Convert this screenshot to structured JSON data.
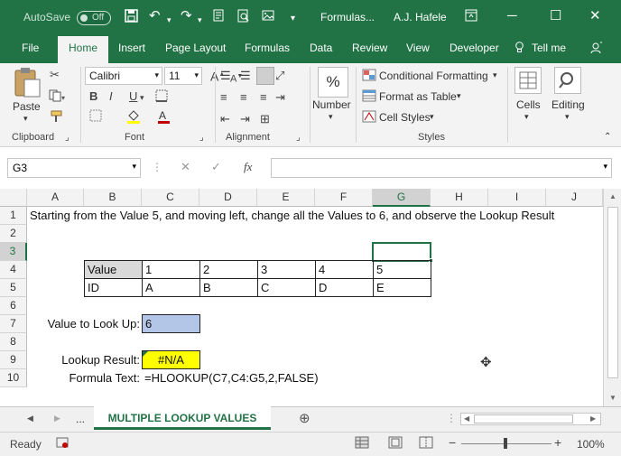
{
  "titlebar": {
    "autosave_label": "AutoSave",
    "autosave_state": "Off",
    "doc_title": "Formulas...",
    "user": "A.J. Hafele"
  },
  "tabs": [
    "File",
    "Home",
    "Insert",
    "Page Layout",
    "Formulas",
    "Data",
    "Review",
    "View",
    "Developer"
  ],
  "tellme": "Tell me",
  "ribbon": {
    "paste_label": "Paste",
    "clipboard_label": "Clipboard",
    "font_name": "Calibri",
    "font_size": "11",
    "font_label": "Font",
    "alignment_label": "Alignment",
    "number_symbol": "%",
    "number_label": "Number",
    "conditional_formatting": "Conditional Formatting",
    "format_as_table": "Format as Table",
    "cell_styles": "Cell Styles",
    "styles_label": "Styles",
    "cells_label": "Cells",
    "editing_label": "Editing"
  },
  "formula_bar": {
    "name_box": "G3",
    "fx": "fx",
    "value": ""
  },
  "columns": [
    "A",
    "B",
    "C",
    "D",
    "E",
    "F",
    "G",
    "H",
    "I",
    "J"
  ],
  "rows": [
    "1",
    "2",
    "3",
    "4",
    "5",
    "6",
    "7",
    "8",
    "9",
    "10"
  ],
  "cells": {
    "a1": "Starting from the Value 5, and moving left, change all the Values to 6, and observe the Lookup Result",
    "b4": "Value",
    "c4": "1",
    "d4": "2",
    "e4": "3",
    "f4": "4",
    "g4": "5",
    "b5": "ID",
    "c5": "A",
    "d5": "B",
    "e5": "C",
    "f5": "D",
    "g5": "E",
    "lookup_label": "Value to Look Up:",
    "lookup_value": "6",
    "result_label": "Lookup Result:",
    "result_value": "#N/A",
    "formula_label": "Formula Text:",
    "formula_text": "=HLOOKUP(C7,C4:G5,2,FALSE)"
  },
  "sheet_tab": {
    "ellipsis": "...",
    "name": "MULTIPLE LOOKUP VALUES"
  },
  "status": {
    "ready": "Ready",
    "zoom": "100%"
  },
  "colors": {
    "excel_green": "#217346",
    "lookup_fill": "#b4c6e7",
    "result_fill": "#ffff00"
  }
}
